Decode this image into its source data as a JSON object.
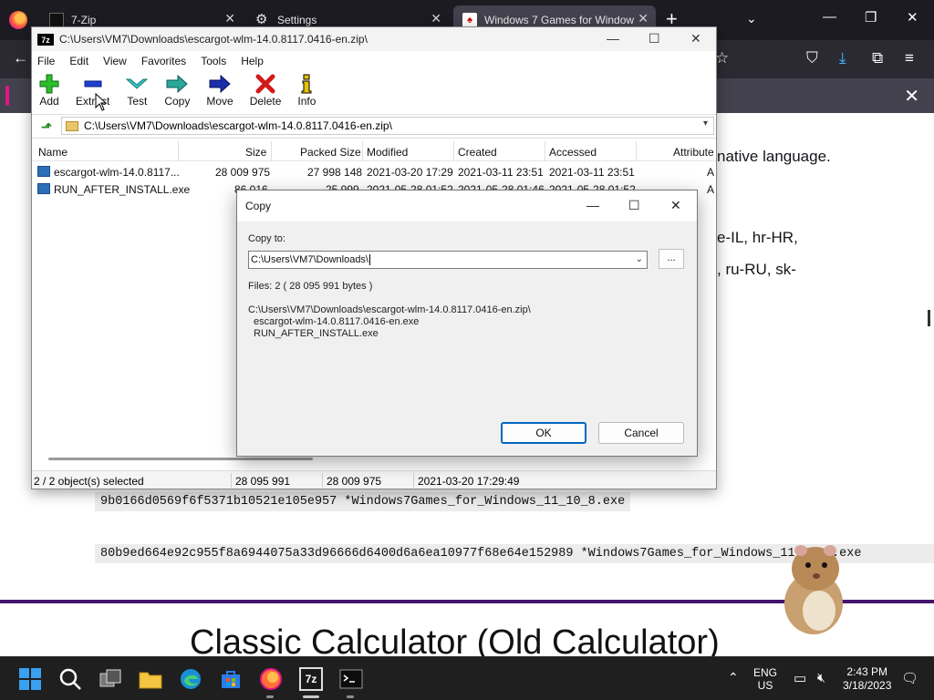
{
  "browser": {
    "tabs": [
      {
        "label": "7-Zip"
      },
      {
        "label": "Settings"
      },
      {
        "label": "Windows 7 Games for Window"
      }
    ],
    "notification_close": "✕",
    "page_text": {
      "line1": "native language.",
      "line2": "e-IL, hr-HR,",
      "line3": ", ru-RU, sk-"
    },
    "hash1": "9b0166d0569f6f5371b10521e105e957 *Windows7Games_for_Windows_11_10_8.exe",
    "hash2": "80b9ed664e92c955f8a6944075a33d96666d6400d6a6ea10977f68e64e152989 *Windows7Games_for_Windows_11_10_8.exe",
    "heading": "Classic Calculator (Old Calculator)"
  },
  "sevenzip": {
    "title": "C:\\Users\\VM7\\Downloads\\escargot-wlm-14.0.8117.0416-en.zip\\",
    "app_badge": "7z",
    "menu": [
      "File",
      "Edit",
      "View",
      "Favorites",
      "Tools",
      "Help"
    ],
    "toolbar": [
      {
        "label": "Add",
        "icon": "add-icon"
      },
      {
        "label": "Extract",
        "icon": "extract-icon"
      },
      {
        "label": "Test",
        "icon": "test-icon"
      },
      {
        "label": "Copy",
        "icon": "copy-icon"
      },
      {
        "label": "Move",
        "icon": "move-icon"
      },
      {
        "label": "Delete",
        "icon": "delete-icon"
      },
      {
        "label": "Info",
        "icon": "info-icon"
      }
    ],
    "address": "C:\\Users\\VM7\\Downloads\\escargot-wlm-14.0.8117.0416-en.zip\\",
    "columns": [
      "Name",
      "Size",
      "Packed Size",
      "Modified",
      "Created",
      "Accessed",
      "Attribute"
    ],
    "rows": [
      {
        "name": "escargot-wlm-14.0.8117...",
        "size": "28 009 975",
        "packed": "27 998 148",
        "modified": "2021-03-20 17:29",
        "created": "2021-03-11 23:51",
        "accessed": "2021-03-11 23:51",
        "attr": "A"
      },
      {
        "name": "RUN_AFTER_INSTALL.exe",
        "size": "86 016",
        "packed": "25 999",
        "modified": "2021-05-28 01:52",
        "created": "2021-05-28 01:46",
        "accessed": "2021-05-28 01:52",
        "attr": "A"
      }
    ],
    "status": {
      "selected": "2 / 2 object(s) selected",
      "size": "28 095 991",
      "packed": "28 009 975",
      "date": "2021-03-20 17:29:49"
    }
  },
  "copy_dialog": {
    "title": "Copy",
    "copy_to_label": "Copy to:",
    "path_value": "C:\\Users\\VM7\\Downloads\\",
    "browse_label": "...",
    "files_info": "Files: 2    ( 28 095 991 bytes )",
    "source_path": "C:\\Users\\VM7\\Downloads\\escargot-wlm-14.0.8117.0416-en.zip\\",
    "file1": "escargot-wlm-14.0.8117.0416-en.exe",
    "file2": "RUN_AFTER_INSTALL.exe",
    "ok_label": "OK",
    "cancel_label": "Cancel"
  },
  "taskbar": {
    "lang_line1": "ENG",
    "lang_line2": "US",
    "time": "2:43 PM",
    "date": "3/18/2023",
    "badge_7z": "7z"
  },
  "colors": {
    "accent": "#0067c0",
    "purple_rule": "#45156e",
    "firefox_pink": "#e31587"
  }
}
